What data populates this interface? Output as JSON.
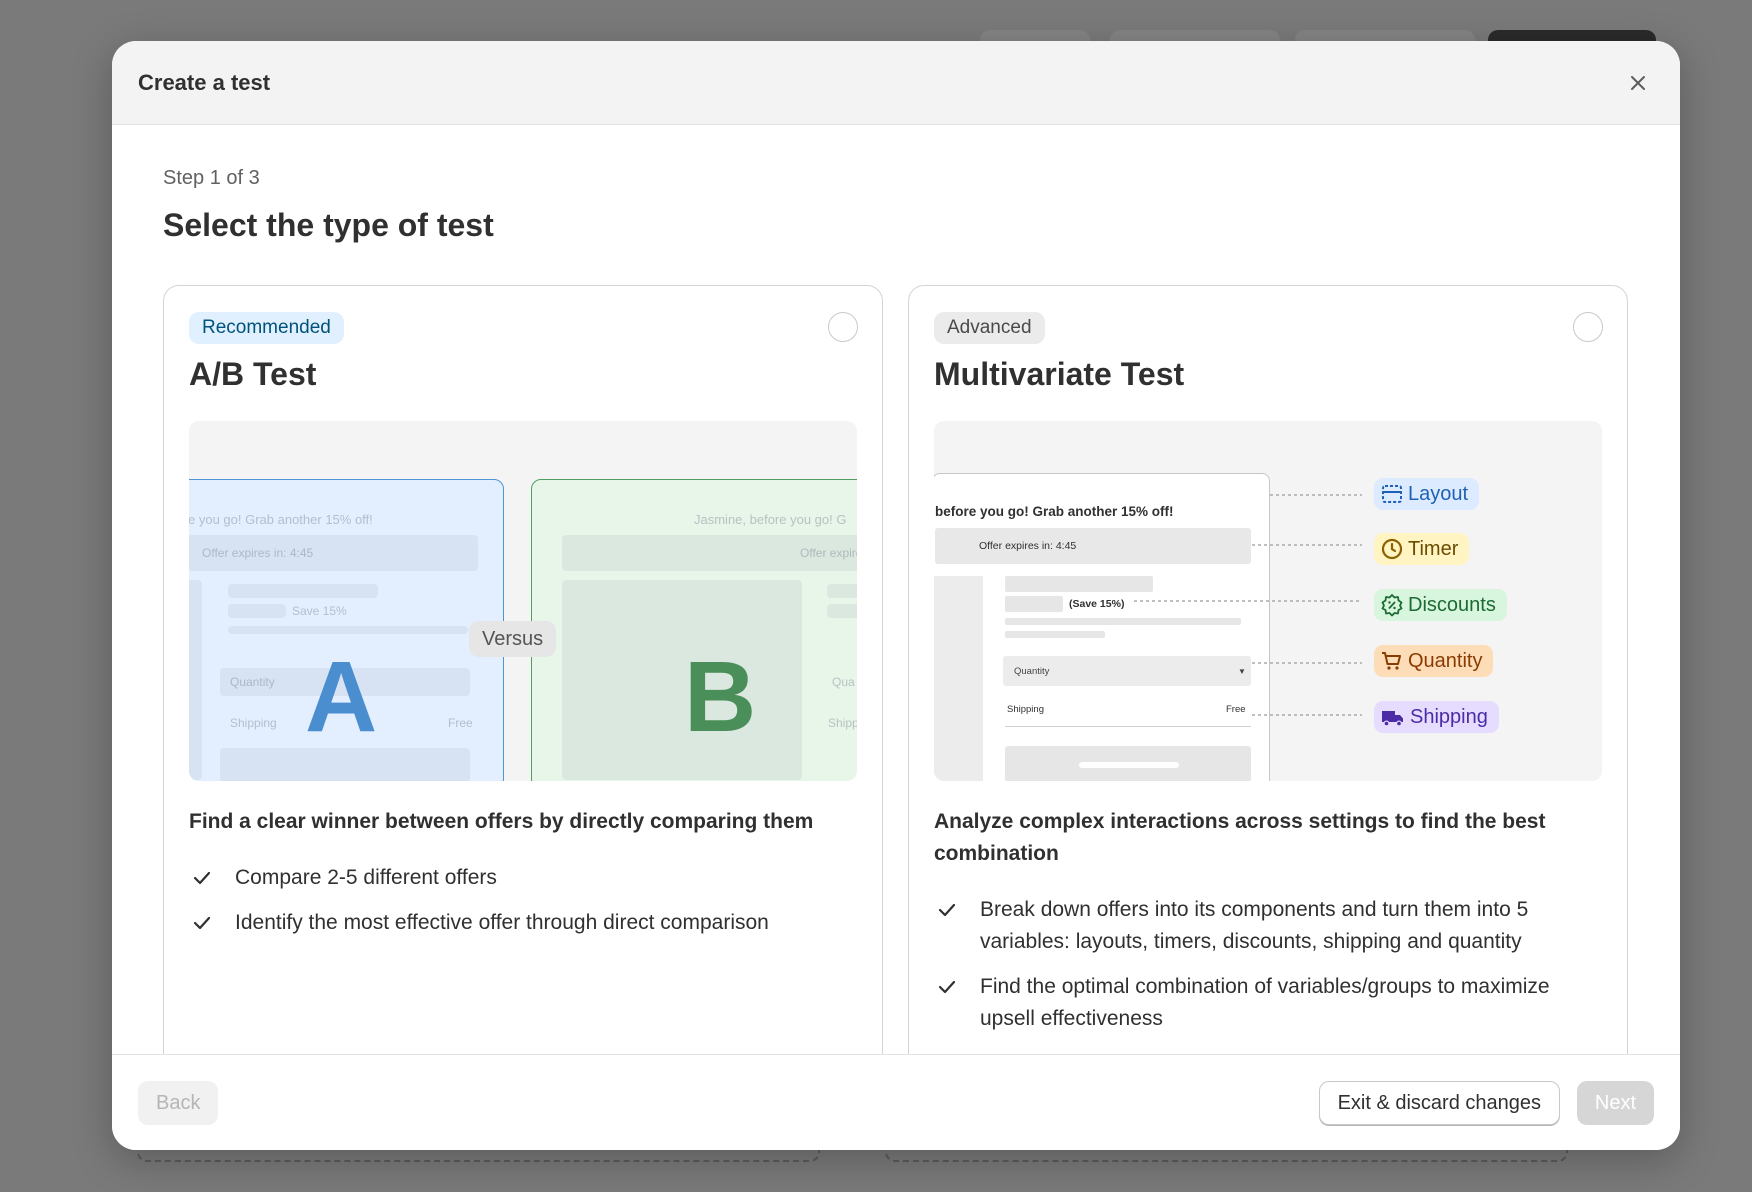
{
  "modal": {
    "title": "Create a test"
  },
  "step": {
    "label": "Step 1 of 3",
    "title": "Select the type of test"
  },
  "cards": [
    {
      "badge": "Recommended",
      "title": "A/B Test",
      "illustration": {
        "letter_a": "A",
        "letter_b": "B",
        "versus": "Versus",
        "a_headline": "e you go! Grab another 15% off!",
        "a_expires": "Offer expires in: 4:45",
        "a_save": "Save 15%",
        "a_quantity": "Quantity",
        "a_shipping": "Shipping",
        "a_free": "Free",
        "b_headline": "Jasmine, before you go! G",
        "b_expires": "Offer expire",
        "b_quantity": "Qua",
        "b_shipping": "Shipp",
        "colors": {
          "a": "#4a8ed0",
          "b": "#4a8e5a"
        }
      },
      "description": "Find a clear winner between offers by directly comparing them",
      "features": [
        "Compare 2-5 different offers",
        "Identify the most effective offer through direct comparison"
      ]
    },
    {
      "badge": "Advanced",
      "title": "Multivariate Test",
      "illustration": {
        "headline": "before you go! Grab another 15% off!",
        "expires": "Offer expires in: 4:45",
        "save": "(Save 15%)",
        "quantity": "Quantity",
        "shipping": "Shipping",
        "free": "Free",
        "tags": [
          {
            "label": "Layout",
            "icon": "layout-icon",
            "bg": "#dcebff",
            "fg": "#1f62b5"
          },
          {
            "label": "Timer",
            "icon": "clock-icon",
            "bg": "#fff4c2",
            "fg": "#6b4c00"
          },
          {
            "label": "Discounts",
            "icon": "discount-icon",
            "bg": "#d8f5de",
            "fg": "#1b6b33"
          },
          {
            "label": "Quantity",
            "icon": "cart-icon",
            "bg": "#fddcb8",
            "fg": "#8a3c00"
          },
          {
            "label": "Shipping",
            "icon": "truck-icon",
            "bg": "#e6dcff",
            "fg": "#4b2ca6"
          }
        ]
      },
      "description": "Analyze complex interactions across settings to find the best combination",
      "features": [
        "Break down offers into its components and turn them into 5 variables: layouts, timers, discounts, shipping and quantity",
        "Find the optimal combination of variables/groups to maximize upsell effectiveness"
      ]
    }
  ],
  "footer": {
    "back": "Back",
    "exit": "Exit & discard changes",
    "next": "Next"
  }
}
